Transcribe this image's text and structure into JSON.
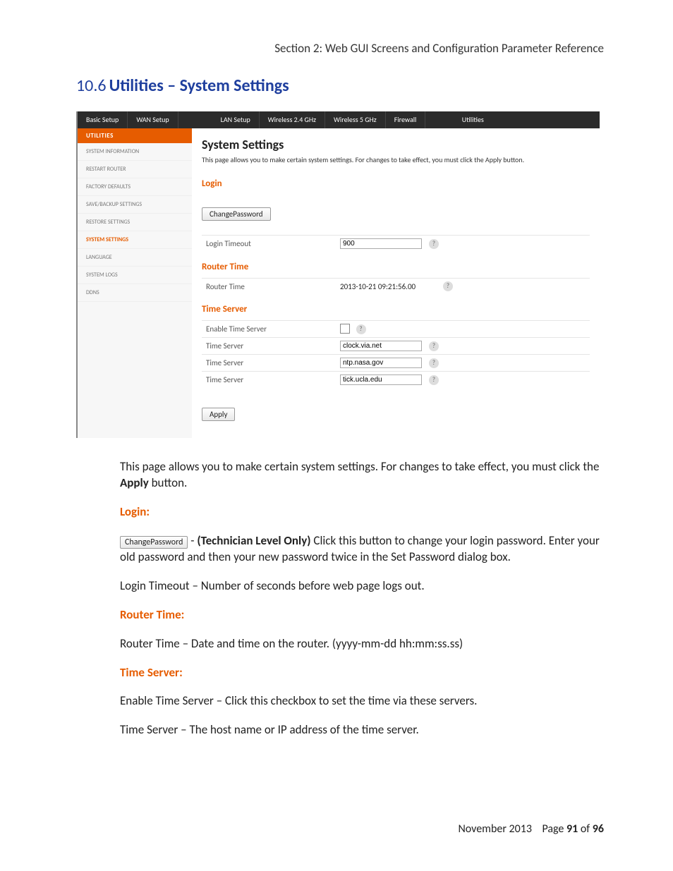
{
  "header": {
    "breadcrumb": "Section 2:  Web GUI Screens and Configuration Parameter Reference"
  },
  "heading": {
    "number": "10.6",
    "title": "Utilities – System Settings"
  },
  "topnav": {
    "items": [
      "Basic Setup",
      "WAN Setup",
      "LAN Setup",
      "Wireless 2.4 GHz",
      "Wireless 5 GHz",
      "Firewall"
    ],
    "active": "Utilities"
  },
  "sidebar": {
    "title": "UTILITIES",
    "items": [
      {
        "label": "SYSTEM INFORMATION",
        "active": false
      },
      {
        "label": "RESTART ROUTER",
        "active": false
      },
      {
        "label": "FACTORY DEFAULTS",
        "active": false
      },
      {
        "label": "SAVE/BACKUP SETTINGS",
        "active": false
      },
      {
        "label": "RESTORE SETTINGS",
        "active": false
      },
      {
        "label": "SYSTEM SETTINGS",
        "active": true
      },
      {
        "label": "LANGUAGE",
        "active": false
      },
      {
        "label": "SYSTEM LOGS",
        "active": false
      },
      {
        "label": "DDNS",
        "active": false
      }
    ]
  },
  "panel": {
    "title": "System Settings",
    "desc": "This page allows you to make certain system settings. For changes to take effect, you must click the Apply button.",
    "login": {
      "heading": "Login",
      "change_pw_btn": "ChangePassword",
      "timeout_label": "Login Timeout",
      "timeout_value": "900"
    },
    "router_time": {
      "heading": "Router Time",
      "label": "Router Time",
      "value": "2013-10-21 09:21:56.00"
    },
    "time_server": {
      "heading": "Time Server",
      "enable_label": "Enable Time Server",
      "rows": [
        {
          "label": "Time Server",
          "value": "clock.via.net"
        },
        {
          "label": "Time Server",
          "value": "ntp.nasa.gov"
        },
        {
          "label": "Time Server",
          "value": "tick.ucla.edu"
        }
      ]
    },
    "apply_btn": "Apply"
  },
  "prose": {
    "p1a": "This page allows you to make certain system settings.  For changes to take effect, you must click the ",
    "p1b": "Apply",
    "p1c": " button.",
    "login_h": "Login:",
    "cp_btn": "ChangePassword",
    "cp_dash": " - ",
    "cp_bold": "(Technician Level Only)",
    "cp_rest": "  Click this button to change your login password.  Enter your old password and then your new password twice in the Set Password dialog box.",
    "lt": "Login Timeout – Number of seconds before web page logs out.",
    "rt_h": "Router Time:",
    "rt": "Router Time – Date and time on the router.  (yyyy-mm-dd   hh:mm:ss.ss)",
    "ts_h": "Time Server:",
    "ts1": "Enable Time Server – Click this checkbox to set the time via these servers.",
    "ts2": "Time Server – The host name or IP address of the time server."
  },
  "footer": {
    "date": "November 2013",
    "page_label": "Page ",
    "page": "91",
    "of": " of ",
    "total": "96"
  }
}
